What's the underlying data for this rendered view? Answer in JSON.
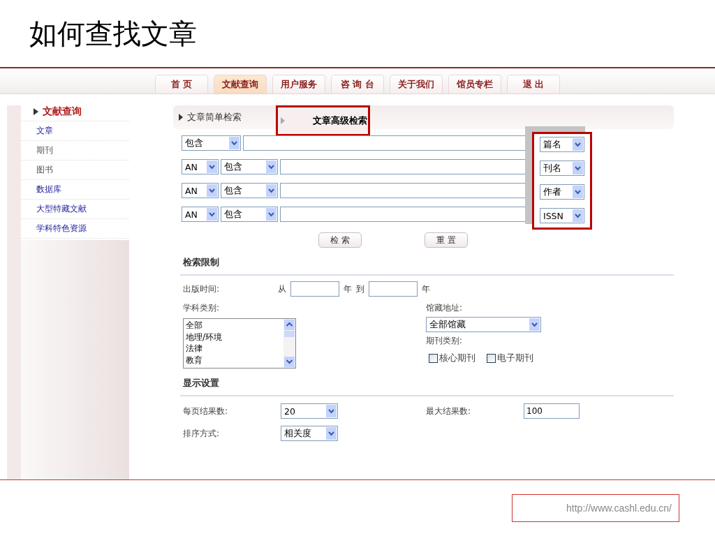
{
  "slide": {
    "title": "如何查找文章",
    "url": "http://www.cashl.edu.cn/"
  },
  "nav": {
    "tabs": [
      {
        "label": "首 页",
        "selected": false
      },
      {
        "label": "文献查询",
        "selected": true
      },
      {
        "label": "用户服务",
        "selected": false
      },
      {
        "label": "咨 询 台",
        "selected": false
      },
      {
        "label": "关于我们",
        "selected": false
      },
      {
        "label": "馆员专栏",
        "selected": false
      },
      {
        "label": "退 出",
        "selected": false
      }
    ]
  },
  "sidebar": {
    "heading": "文献查询",
    "items": [
      {
        "label": "文章",
        "disabled": false
      },
      {
        "label": "期刊",
        "disabled": true
      },
      {
        "label": "图书",
        "disabled": true
      },
      {
        "label": "数据库",
        "disabled": false
      },
      {
        "label": "大型特藏文献",
        "disabled": false
      },
      {
        "label": "学科特色资源",
        "disabled": false
      }
    ]
  },
  "search_tabs": [
    {
      "label": "文章简单检索",
      "selected": false,
      "highlighted": false
    },
    {
      "label": "文章高级检索",
      "selected": true,
      "highlighted": true
    }
  ],
  "search": {
    "fields_highlighted": true,
    "rows": [
      {
        "operator": null,
        "match": "包含",
        "field": "篇名"
      },
      {
        "operator": "AN",
        "match": "包含",
        "field": "刊名"
      },
      {
        "operator": "AN",
        "match": "包含",
        "field": "作者"
      },
      {
        "operator": "AN",
        "match": "包含",
        "field": "ISSN"
      }
    ],
    "buttons": [
      "检 索",
      "重 置"
    ]
  },
  "limits": {
    "heading": "检索限制",
    "date_label": "出版时间:",
    "from": "从",
    "year_1": "年",
    "to": "到",
    "year_2": "年",
    "subject_label": "学科类别:",
    "subjects": [
      "全部",
      "地理/环境",
      "法律",
      "教育"
    ],
    "location_label": "馆藏地址:",
    "location": "全部馆藏",
    "journal_type_label": "期刊类别:",
    "journal_types": [
      {
        "label": "核心期刊",
        "checked": false
      },
      {
        "label": "电子期刊",
        "checked": false
      }
    ]
  },
  "display": {
    "heading": "显示设置",
    "per_page_label": "每页结果数:",
    "per_page": "20",
    "max_label": "最大结果数:",
    "max": "100",
    "sort_label": "排序方式:",
    "sort": "相关度"
  }
}
